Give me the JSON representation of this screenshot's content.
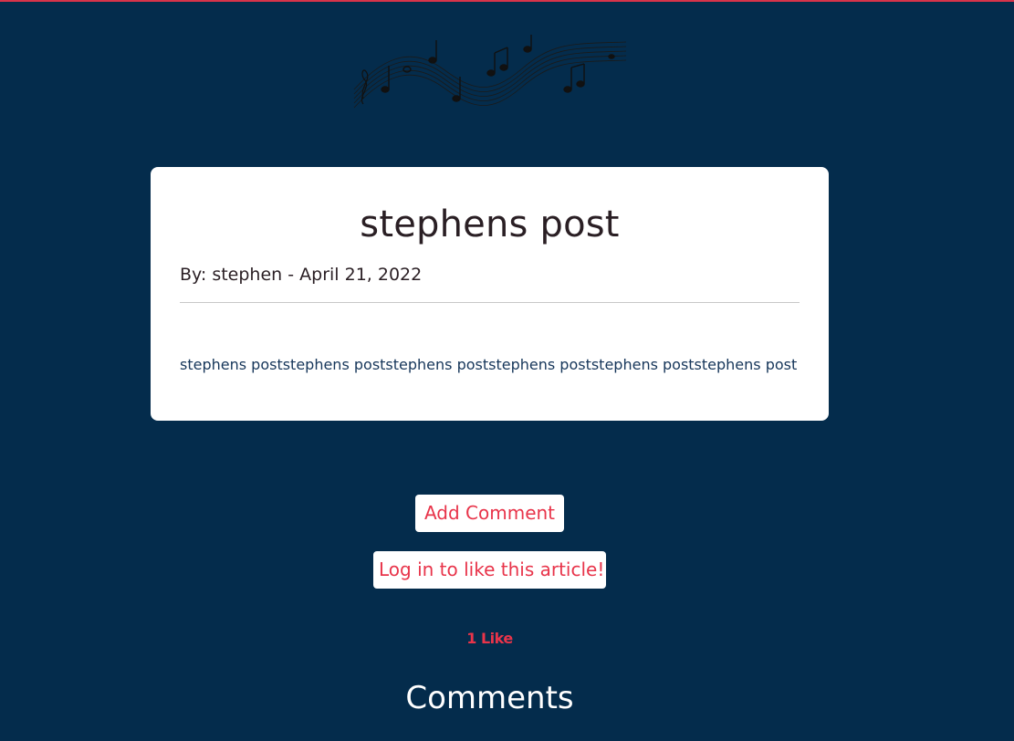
{
  "post": {
    "title": "stephens post",
    "byline": "By: stephen - April 21, 2022",
    "content": "stephens poststephens poststephens poststephens poststephens poststephens post"
  },
  "actions": {
    "add_comment_label": "Add Comment",
    "login_like_label": "Log in to like this article!"
  },
  "likes": {
    "count_label": "1 Like"
  },
  "comments": {
    "heading": "Comments"
  },
  "colors": {
    "background": "#042c4c",
    "accent": "#e8344a",
    "card": "#ffffff"
  },
  "icons": {
    "banner": "music-notes-icon"
  }
}
